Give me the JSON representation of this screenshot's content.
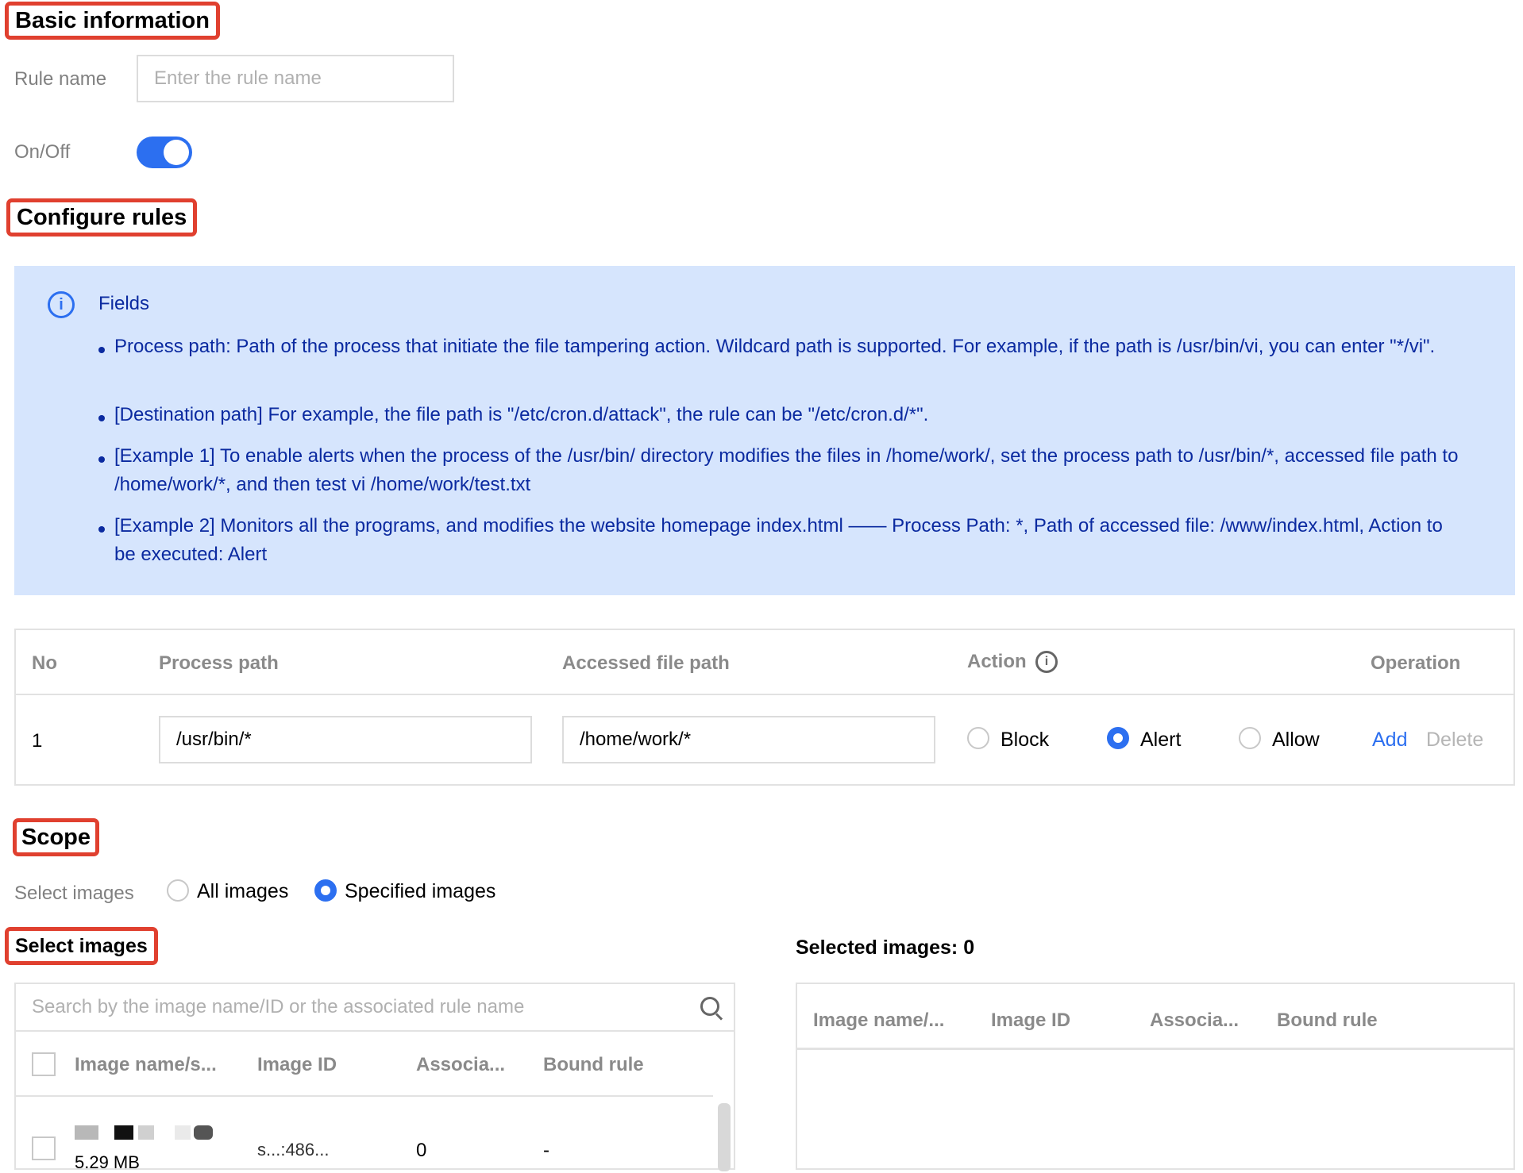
{
  "basic_info": {
    "title": "Basic information",
    "rule_name_label": "Rule name",
    "rule_name_placeholder": "Enter the rule name",
    "onoff_label": "On/Off",
    "enabled": true
  },
  "configure": {
    "title": "Configure rules",
    "info": {
      "heading": "Fields",
      "items": [
        "Process path: Path of the process that initiate the file tampering action. Wildcard path is supported. For example, if the path is /usr/bin/vi, you can enter \"*/vi\".",
        "[Destination path] For example, the file path is \"/etc/cron.d/attack\", the rule can be \"/etc/cron.d/*\".",
        "[Example 1] To enable alerts when the process of the /usr/bin/ directory modifies the files in /home/work/, set the process path to /usr/bin/*, accessed file path to /home/work/*, and then test vi /home/work/test.txt",
        "[Example 2] Monitors all the programs, and modifies the website homepage index.html —— Process Path: *, Path of accessed file: /www/index.html, Action to be executed: Alert"
      ]
    },
    "table": {
      "headers": {
        "no": "No",
        "process": "Process path",
        "file": "Accessed file path",
        "action": "Action",
        "operation": "Operation"
      },
      "rows": [
        {
          "no": "1",
          "process_path": "/usr/bin/*",
          "file_path": "/home/work/*",
          "action": "Alert"
        }
      ],
      "actions": [
        "Block",
        "Alert",
        "Allow"
      ],
      "op_add": "Add",
      "op_delete": "Delete"
    }
  },
  "scope": {
    "title": "Scope",
    "select_label": "Select images",
    "options": [
      "All images",
      "Specified images"
    ],
    "selected": "Specified images"
  },
  "select_images": {
    "title": "Select images",
    "search_placeholder": "Search by the image name/ID or the associated rule name",
    "headers": [
      "Image name/s...",
      "Image ID",
      "Associa...",
      "Bound rule"
    ],
    "rows": [
      {
        "size": "5.29 MB",
        "image_id": "s...:486...",
        "associated": "0",
        "bound_rule": "-"
      }
    ]
  },
  "selected_images": {
    "title": "Selected images: 0",
    "headers": [
      "Image name/...",
      "Image ID",
      "Associa...",
      "Bound rule"
    ]
  },
  "colors": {
    "accent": "#2c6ff0",
    "highlight_border": "#e0402f",
    "info_bg": "#d6e5fd",
    "info_text": "#0b2aa0"
  }
}
